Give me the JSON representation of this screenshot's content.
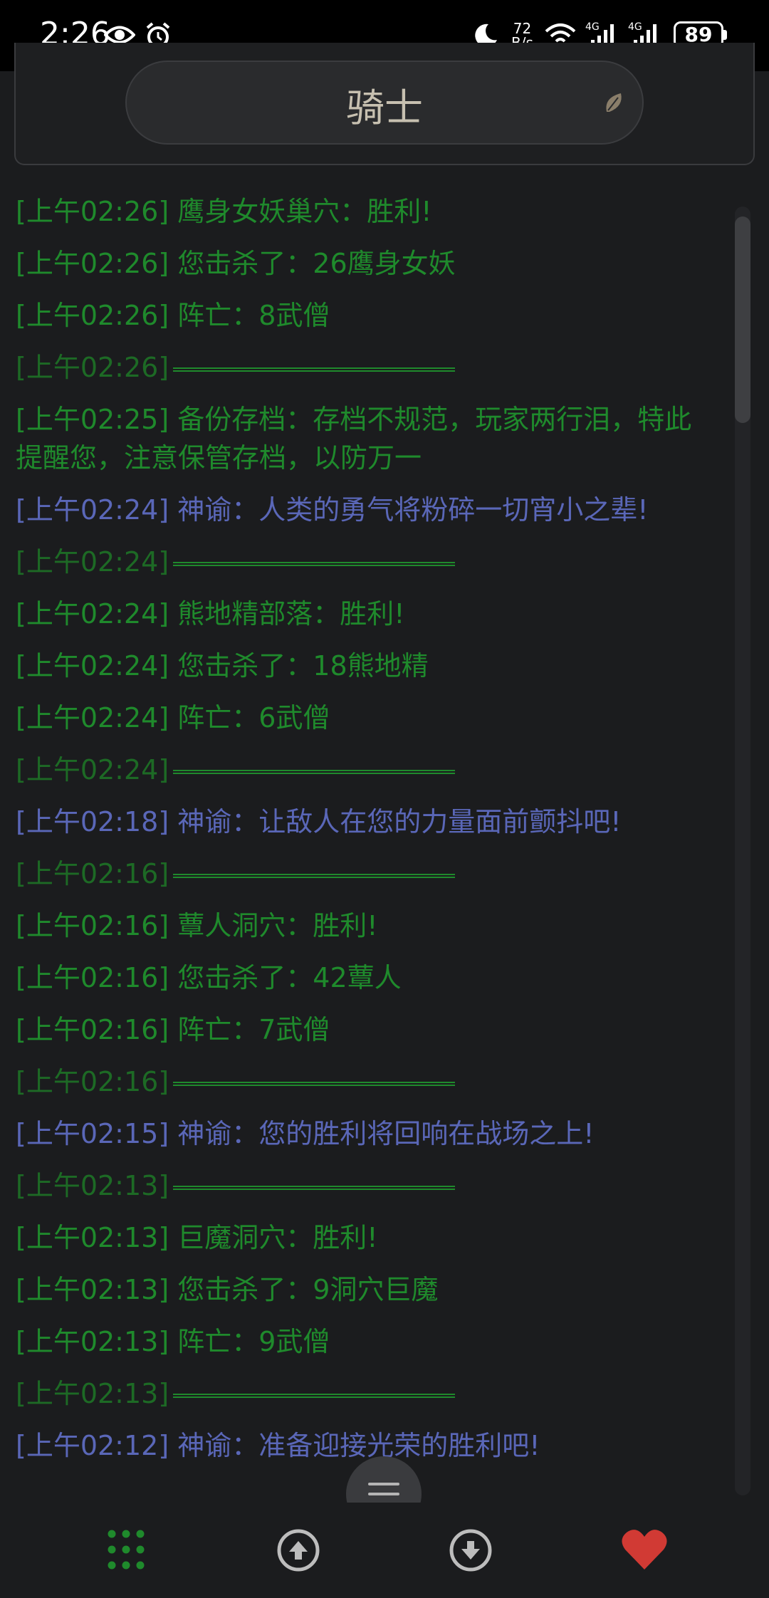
{
  "status_bar": {
    "time": "2:26",
    "network_speed_value": "72",
    "network_speed_unit": "B/s",
    "battery": "89",
    "icons": [
      "eye-icon",
      "alarm-icon",
      "moon-icon",
      "wifi-icon",
      "signal-4g-icon",
      "signal-4g-icon"
    ]
  },
  "header": {
    "title": "骑士"
  },
  "log": [
    {
      "type": "green",
      "time": "[上午02:26]",
      "text": "鹰身女妖巢穴：胜利!"
    },
    {
      "type": "green",
      "time": "[上午02:26]",
      "text": "您击杀了：26鹰身女妖"
    },
    {
      "type": "green",
      "time": "[上午02:26]",
      "text": "阵亡：8武僧"
    },
    {
      "type": "divider",
      "time": "[上午02:26]",
      "text": ""
    },
    {
      "type": "green",
      "time": "[上午02:25]",
      "text": "备份存档：存档不规范，玩家两行泪，特此提醒您，注意保管存档，以防万一"
    },
    {
      "type": "blue",
      "time": "[上午02:24]",
      "text": "神谕：人类的勇气将粉碎一切宵小之辈!"
    },
    {
      "type": "divider",
      "time": "[上午02:24]",
      "text": ""
    },
    {
      "type": "green",
      "time": "[上午02:24]",
      "text": "熊地精部落：胜利!"
    },
    {
      "type": "green",
      "time": "[上午02:24]",
      "text": "您击杀了：18熊地精"
    },
    {
      "type": "green",
      "time": "[上午02:24]",
      "text": "阵亡：6武僧"
    },
    {
      "type": "divider",
      "time": "[上午02:24]",
      "text": ""
    },
    {
      "type": "blue",
      "time": "[上午02:18]",
      "text": "神谕：让敌人在您的力量面前颤抖吧!"
    },
    {
      "type": "divider",
      "time": "[上午02:16]",
      "text": ""
    },
    {
      "type": "green",
      "time": "[上午02:16]",
      "text": "蕈人洞穴：胜利!"
    },
    {
      "type": "green",
      "time": "[上午02:16]",
      "text": "您击杀了：42蕈人"
    },
    {
      "type": "green",
      "time": "[上午02:16]",
      "text": "阵亡：7武僧"
    },
    {
      "type": "divider",
      "time": "[上午02:16]",
      "text": ""
    },
    {
      "type": "blue",
      "time": "[上午02:15]",
      "text": "神谕：您的胜利将回响在战场之上!"
    },
    {
      "type": "divider",
      "time": "[上午02:13]",
      "text": ""
    },
    {
      "type": "green",
      "time": "[上午02:13]",
      "text": "巨魔洞穴：胜利!"
    },
    {
      "type": "green",
      "time": "[上午02:13]",
      "text": "您击杀了：9洞穴巨魔"
    },
    {
      "type": "green",
      "time": "[上午02:13]",
      "text": "阵亡：9武僧"
    },
    {
      "type": "divider",
      "time": "[上午02:13]",
      "text": ""
    },
    {
      "type": "blue",
      "time": "[上午02:12]",
      "text": "神谕：准备迎接光荣的胜利吧!"
    }
  ],
  "bottom_nav": {
    "buttons": [
      "grid-icon",
      "scroll-up-icon",
      "scroll-down-icon",
      "heart-icon"
    ]
  },
  "colors": {
    "green_text": "#1f8a2c",
    "blue_text": "#5a67b8",
    "heart": "#d13a34"
  }
}
